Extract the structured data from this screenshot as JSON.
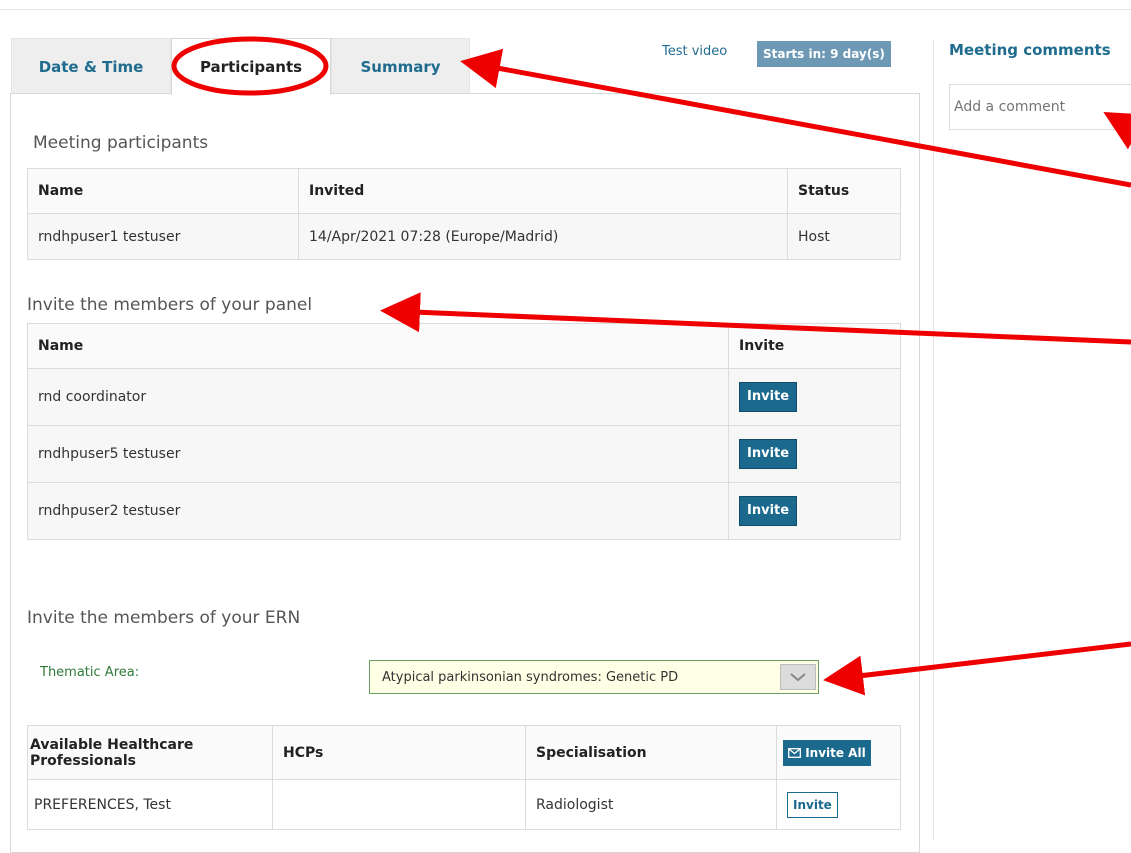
{
  "tabs": [
    {
      "label": "Date & Time"
    },
    {
      "label": "Participants"
    },
    {
      "label": "Summary"
    }
  ],
  "meeting": {
    "title": "Test video",
    "starts_badge": "Starts in: 9 day(s)"
  },
  "participants": {
    "section_title": "Meeting participants",
    "headers": [
      "Name",
      "Invited",
      "Status"
    ],
    "rows": [
      {
        "name": "rndhpuser1 testuser",
        "invited": "14/Apr/2021 07:28 (Europe/Madrid)",
        "status": "Host"
      }
    ]
  },
  "panel": {
    "section_title": "Invite the members of your panel",
    "headers": [
      "Name",
      "Invite"
    ],
    "invite_label": "Invite",
    "rows": [
      {
        "name": "rnd coordinator"
      },
      {
        "name": "rndhpuser5 testuser"
      },
      {
        "name": "rndhpuser2 testuser"
      }
    ]
  },
  "ern": {
    "section_title": "Invite the members of your ERN",
    "thematic_label": "Thematic Area:",
    "thematic_value": "Atypical parkinsonian syndromes: Genetic PD",
    "headers": [
      "Available Healthcare Professionals",
      "HCPs",
      "Specialisation"
    ],
    "invite_all_label": "Invite All",
    "invite_label": "Invite",
    "rows": [
      {
        "name": "PREFERENCES, Test",
        "hcps": "",
        "specialisation": "Radiologist"
      }
    ]
  },
  "comments": {
    "title": "Meeting comments",
    "placeholder": "Add a comment"
  },
  "colors": {
    "accent": "#1b6a8e",
    "annotation": "#ee0000"
  },
  "icons": {
    "invite_all": "envelope-icon",
    "select": "chevron-down-icon"
  }
}
